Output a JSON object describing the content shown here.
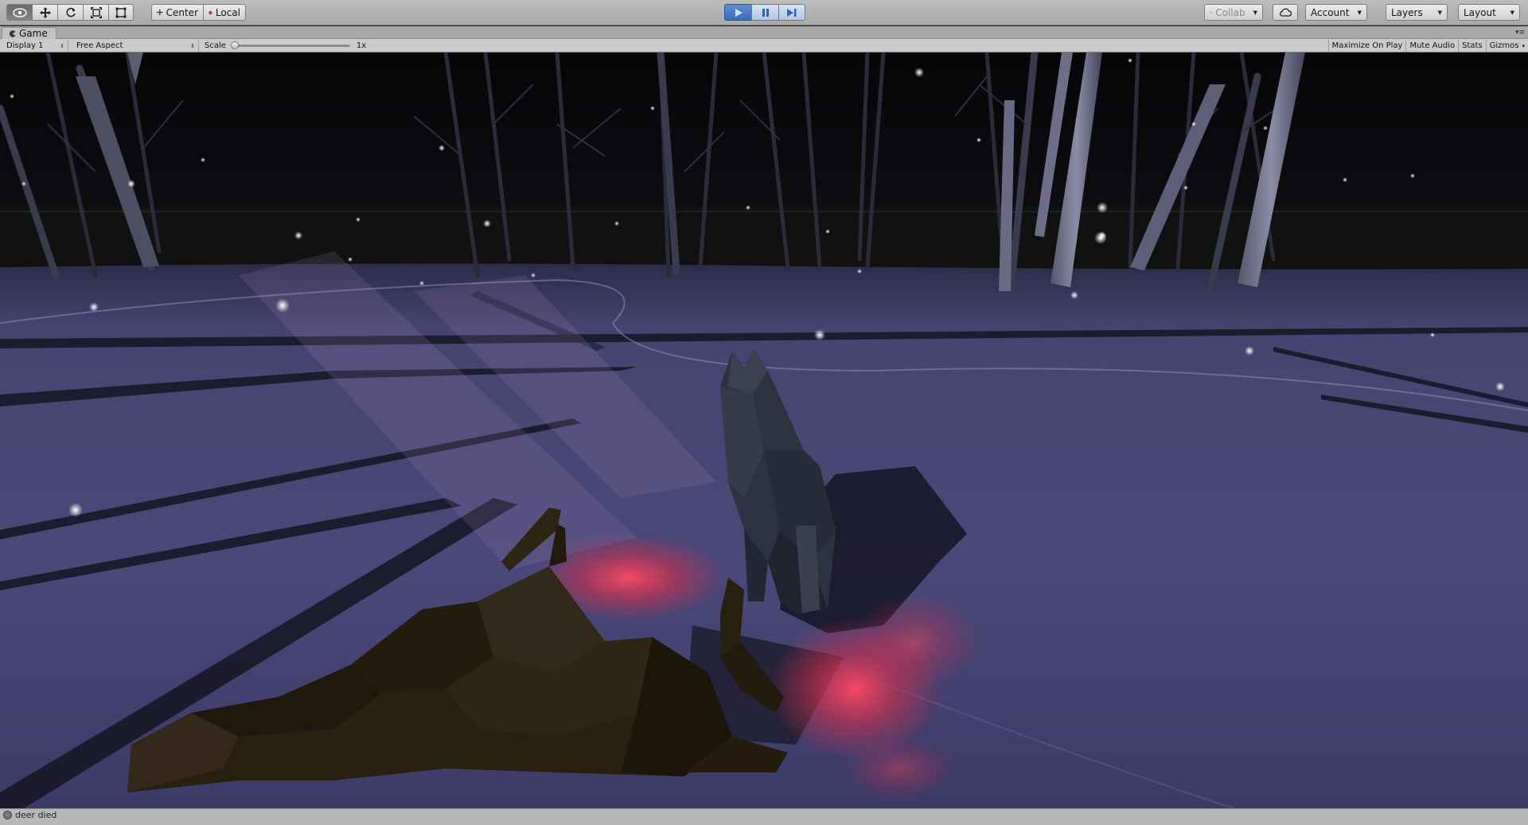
{
  "toolbar": {
    "transform_tools": [
      "view-tool",
      "move-tool",
      "rotate-tool",
      "scale-tool",
      "rect-tool"
    ],
    "pivot_label": "Center",
    "space_label": "Local",
    "playback": [
      "play",
      "pause",
      "step"
    ],
    "collab_label": "Collab",
    "account_label": "Account",
    "layers_label": "Layers",
    "layout_label": "Layout"
  },
  "game_window": {
    "tab_label": "Game",
    "display_label": "Display 1",
    "aspect_label": "Free Aspect",
    "scale_label": "Scale",
    "scale_value": "1x",
    "scale_level": 0.0,
    "maximize_label": "Maximize On Play",
    "mute_label": "Mute Audio",
    "stats_label": "Stats",
    "gizmos_label": "Gizmos"
  },
  "scene": {
    "description_icon": "game-scene",
    "sky_color": "#07070b",
    "snow_color": "#4a4878",
    "blood_color": "#ff3a55",
    "deer_color": "#2a2010",
    "wolf_color": "#2c3340"
  },
  "status": {
    "message": "deer died"
  }
}
